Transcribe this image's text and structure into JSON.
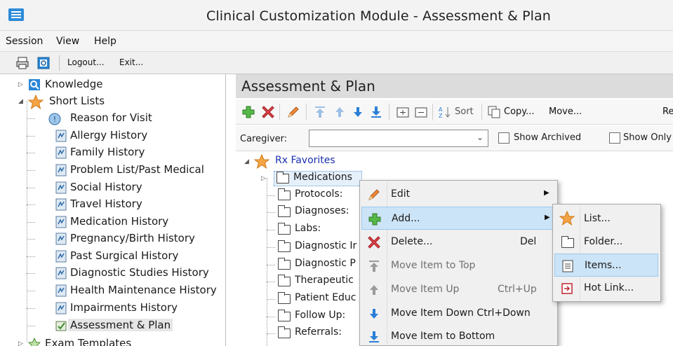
{
  "window": {
    "title": "Clinical Customization Module - Assessment & Plan"
  },
  "menubar": {
    "items": [
      "Session",
      "View",
      "Help"
    ]
  },
  "toolbar": {
    "logout_label": "Logout...",
    "exit_label": "Exit..."
  },
  "left_tree": {
    "knowledge": "Knowledge",
    "short_lists": "Short Lists",
    "items": [
      "Reason for Visit",
      "Allergy History",
      "Family History",
      "Problem List/Past Medical",
      "Social History",
      "Travel History",
      "Medication History",
      "Pregnancy/Birth History",
      "Past Surgical History",
      "Diagnostic Studies History",
      "Health Maintenance History",
      "Impairments History",
      "Assessment & Plan"
    ],
    "selected": "Assessment & Plan",
    "exam_templates": "Exam Templates"
  },
  "main": {
    "header_title": "Assessment & Plan",
    "toolbar": {
      "sort_label": "Sort",
      "copy_label": "Copy...",
      "move_label": "Move...",
      "cut_label": "Re"
    },
    "caregiver_label": "Caregiver:",
    "caregiver_value": "",
    "show_archived_label": "Show Archived",
    "show_only_label": "Show Only",
    "tree": {
      "root": "Rx Favorites",
      "folders": [
        "Medications",
        "Protocols:",
        "Diagnoses:",
        "Labs:",
        "Diagnostic Ir",
        "Diagnostic P",
        "Therapeutic",
        "Patient Educ",
        "Follow Up:",
        "Referrals:"
      ]
    }
  },
  "context_menu": {
    "items": [
      {
        "label": "Edit",
        "shortcut": "",
        "submenu": true,
        "disabled": false
      },
      {
        "label": "Add...",
        "shortcut": "",
        "submenu": true,
        "disabled": false
      },
      {
        "label": "Delete...",
        "shortcut": "Del",
        "submenu": false,
        "disabled": false
      },
      {
        "label": "Move Item to Top",
        "shortcut": "",
        "submenu": false,
        "disabled": true
      },
      {
        "label": "Move Item Up",
        "shortcut": "Ctrl+Up",
        "submenu": false,
        "disabled": true
      },
      {
        "label": "Move Item Down Ctrl+Down",
        "shortcut": "",
        "submenu": false,
        "disabled": false
      },
      {
        "label": "Move Item to Bottom",
        "shortcut": "",
        "submenu": false,
        "disabled": false
      }
    ],
    "highlighted": "Add..."
  },
  "submenu": {
    "items": [
      "List...",
      "Folder...",
      "Items...",
      "Hot Link..."
    ],
    "highlighted": "Items..."
  },
  "colors": {
    "highlight": "#cce4f7",
    "header_bg": "#dcdcdc",
    "link_blue": "#1a2fb0",
    "add_green": "#3aa337",
    "delete_red": "#d9323a",
    "arrow_blue": "#2b7fd6"
  }
}
